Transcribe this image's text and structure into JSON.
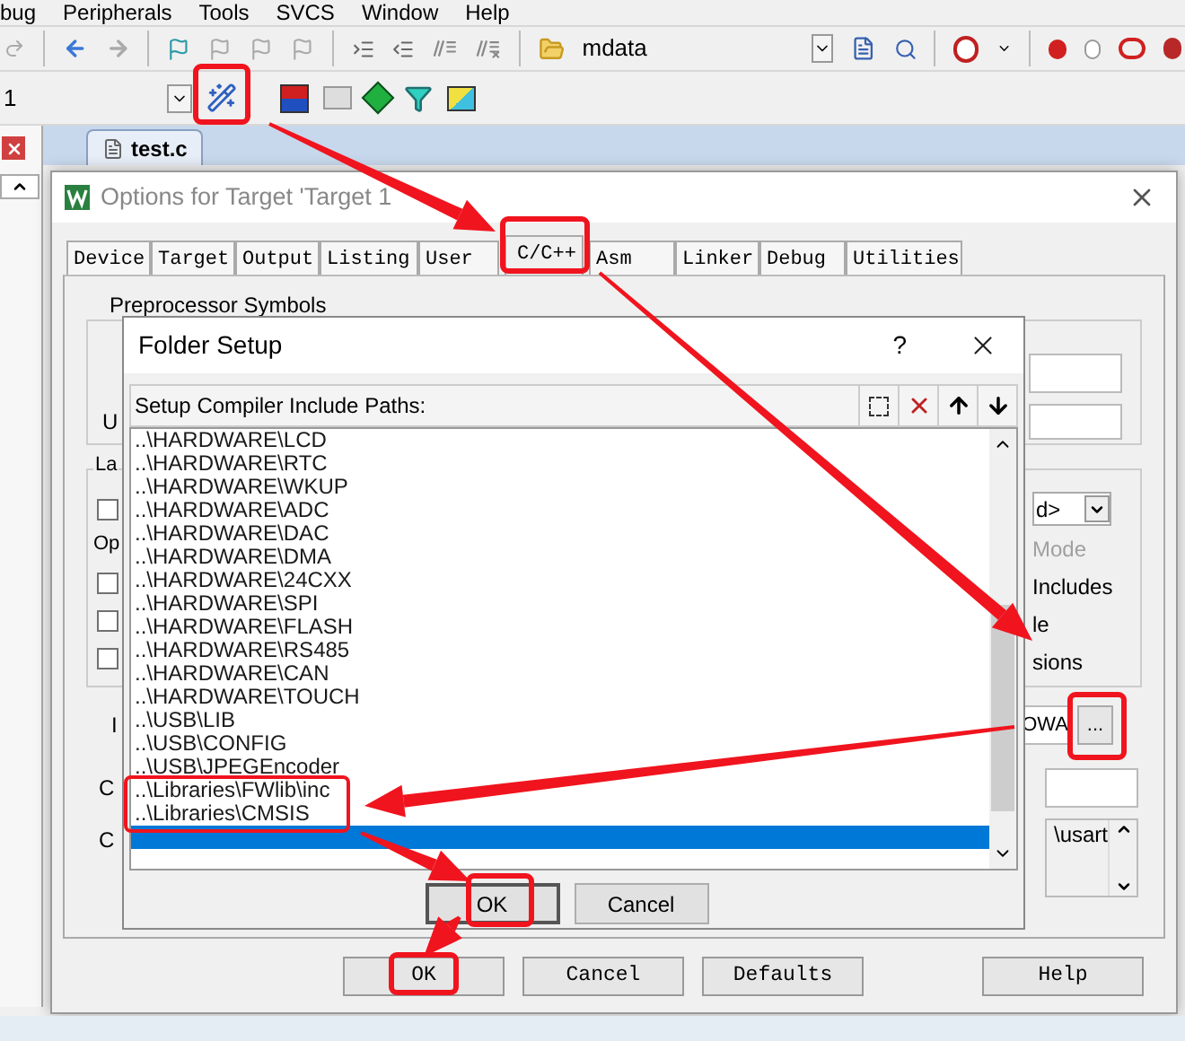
{
  "menu": [
    {
      "label": "bug"
    },
    {
      "label": "Peripherals"
    },
    {
      "label": "Tools"
    },
    {
      "label": "SVCS"
    },
    {
      "label": "Window"
    },
    {
      "label": "Help"
    }
  ],
  "toolbar": {
    "find_text": "mdata"
  },
  "target_combo": {
    "value": "1"
  },
  "editor_tabs": [
    {
      "label": "test.c",
      "selected": true
    }
  ],
  "options_dialog": {
    "title": "Options for Target 'Target 1",
    "tabs": [
      {
        "label": "Device",
        "selected": false
      },
      {
        "label": "Target",
        "selected": false
      },
      {
        "label": "Output",
        "selected": false
      },
      {
        "label": "Listing",
        "selected": false
      },
      {
        "label": "User",
        "selected": false
      },
      {
        "label": "C/C++",
        "selected": true
      },
      {
        "label": "Asm",
        "selected": false
      },
      {
        "label": "Linker",
        "selected": false
      },
      {
        "label": "Debug",
        "selected": false
      },
      {
        "label": "Utilities",
        "selected": false
      }
    ],
    "preprocessor_title": "Preprocessor Symbols",
    "undefine_label": "U",
    "language_title": "La",
    "optimization_label": "Op",
    "checkboxes": [
      {
        "checked": false
      },
      {
        "checked": false
      },
      {
        "checked": false
      },
      {
        "checked": false
      }
    ],
    "dropdown_value": "d>",
    "mode": {
      "label": "Mode",
      "disabled": true
    },
    "option_labels": [
      "Includes",
      "le",
      "sions"
    ],
    "include_label": "I",
    "include_paths_value": "OWA",
    "browse_button": "...",
    "misc_label": "C",
    "compiler_label": "C",
    "compiler_string": "\\usart",
    "buttons": [
      "OK",
      "Cancel",
      "Defaults",
      "Help"
    ]
  },
  "folder_setup": {
    "title": "Folder Setup",
    "help": "?",
    "header": "Setup Compiler Include Paths:",
    "paths": [
      {
        "text": "..\\HARDWARE\\LCD",
        "selected": false
      },
      {
        "text": "..\\HARDWARE\\RTC",
        "selected": false
      },
      {
        "text": "..\\HARDWARE\\WKUP",
        "selected": false
      },
      {
        "text": "..\\HARDWARE\\ADC",
        "selected": false
      },
      {
        "text": "..\\HARDWARE\\DAC",
        "selected": false
      },
      {
        "text": "..\\HARDWARE\\DMA",
        "selected": false
      },
      {
        "text": "..\\HARDWARE\\24CXX",
        "selected": false
      },
      {
        "text": "..\\HARDWARE\\SPI",
        "selected": false
      },
      {
        "text": "..\\HARDWARE\\FLASH",
        "selected": false
      },
      {
        "text": "..\\HARDWARE\\RS485",
        "selected": false
      },
      {
        "text": "..\\HARDWARE\\CAN",
        "selected": false
      },
      {
        "text": "..\\HARDWARE\\TOUCH",
        "selected": false
      },
      {
        "text": "..\\USB\\LIB",
        "selected": false
      },
      {
        "text": "..\\USB\\CONFIG",
        "selected": false
      },
      {
        "text": "..\\USB\\JPEGEncoder",
        "selected": false
      },
      {
        "text": "..\\Libraries\\FWlib\\inc",
        "selected": false
      },
      {
        "text": "..\\Libraries\\CMSIS",
        "selected": false
      },
      {
        "selected": true
      }
    ],
    "buttons": [
      "OK",
      "Cancel"
    ]
  }
}
